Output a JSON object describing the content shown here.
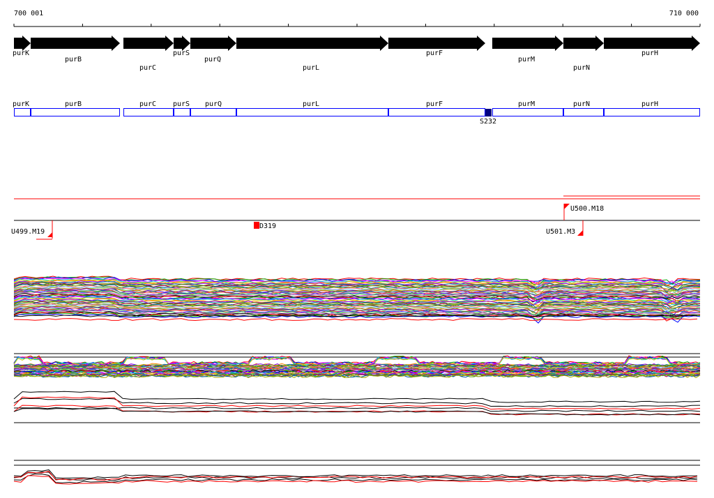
{
  "coordinates": {
    "start_label": "700 001",
    "end_label": "710 000"
  },
  "colors": {
    "gene_arrow": "#000000",
    "gene_box": "#0000ff",
    "highlight": "#000080",
    "marker": "#ff0000",
    "line": "#000000",
    "background": "#ffffff"
  },
  "genes": [
    {
      "name": "purK"
    },
    {
      "name": "purB"
    },
    {
      "name": "purC"
    },
    {
      "name": "purS"
    },
    {
      "name": "purQ"
    },
    {
      "name": "purL"
    },
    {
      "name": "purF"
    },
    {
      "name": "purM"
    },
    {
      "name": "purN"
    },
    {
      "name": "purH"
    }
  ],
  "highlight_label": "S232",
  "markers": [
    {
      "label": "U500.M18"
    },
    {
      "label": "U499.M19"
    },
    {
      "label": "D319"
    },
    {
      "label": "U501.M3"
    }
  ],
  "panels": [
    {
      "name": "expression-panel-1"
    },
    {
      "name": "expression-panel-2"
    },
    {
      "name": "expression-panel-3"
    },
    {
      "name": "expression-panel-4"
    }
  ]
}
